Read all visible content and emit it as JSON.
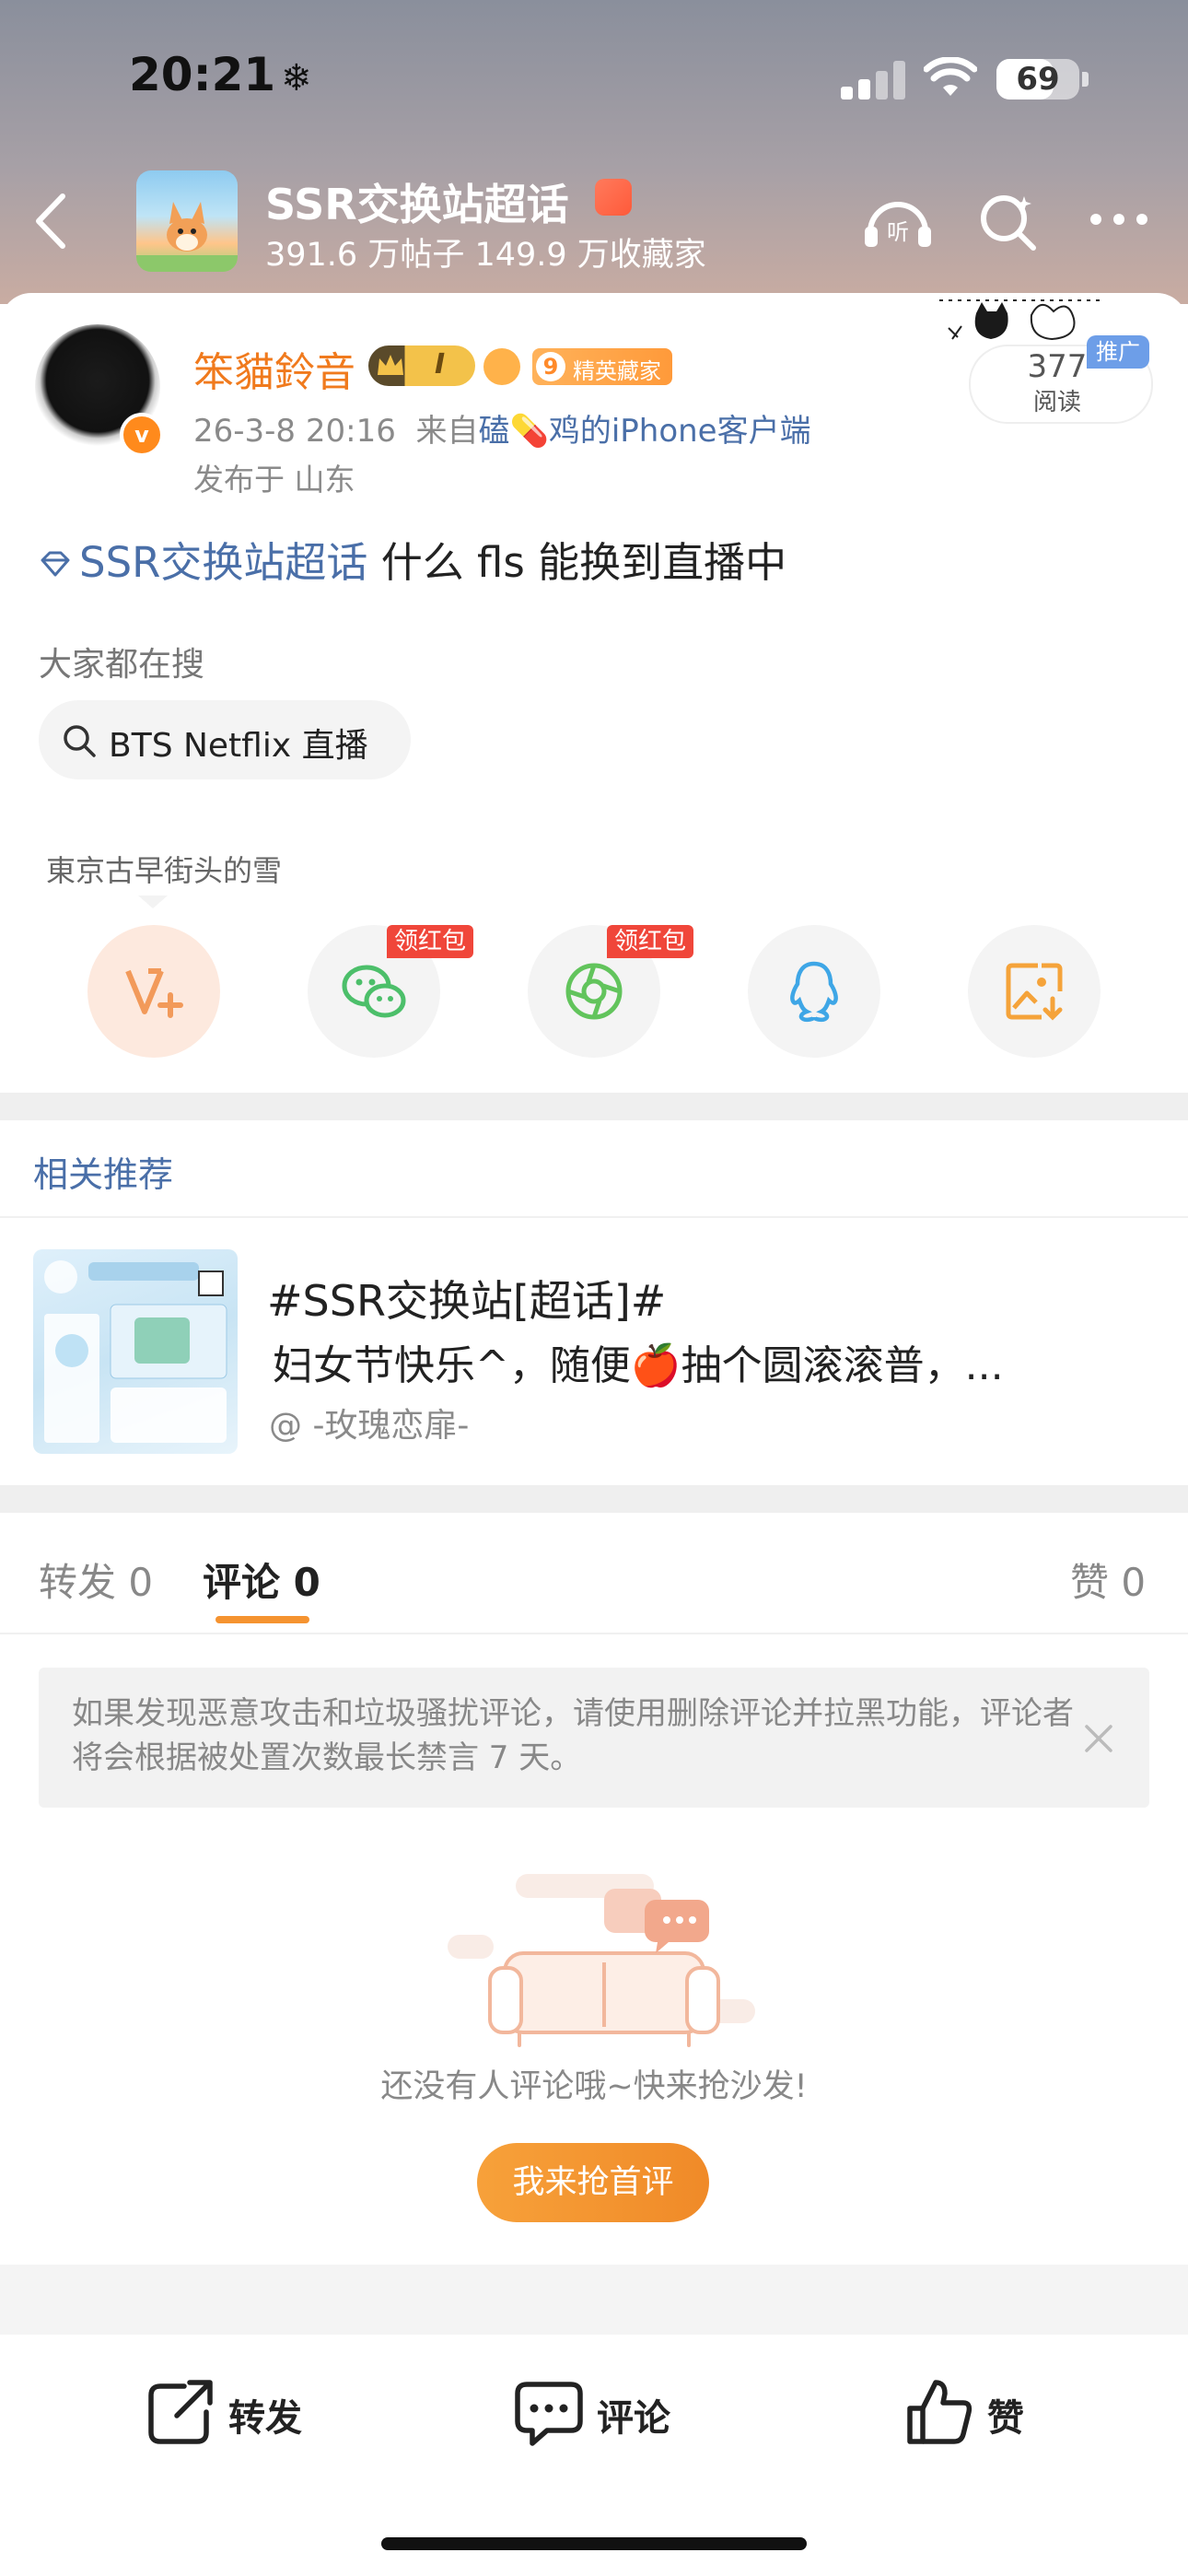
{
  "status_bar": {
    "time": "20:21",
    "time_suffix_icon": "snowflake-icon",
    "battery": "69",
    "battery_level": 0.69
  },
  "nav": {
    "topic_title": "SSR交换站超话",
    "topic_stats": "391.6 万帖子 149.9 万收藏家"
  },
  "post": {
    "author_name": "笨貓鈴音",
    "crown_level": "I",
    "vip_level": "9",
    "vip_label": "精英藏家",
    "date": "26-3-8 20:16",
    "source_prefix": "来自",
    "source": "磕💊鸡的iPhone客户端",
    "location": "发布于 山东",
    "read_count": "377",
    "read_label": "阅读",
    "promo_tag": "推广",
    "topic_link": "SSR交换站超话",
    "text": " 什么 fls 能换到直播中"
  },
  "search_suggest": {
    "heading": "大家都在搜",
    "chip": "BTS Netflix 直播"
  },
  "share": {
    "tooltip": "東京古早街头的雪",
    "redpack_label": "领红包",
    "buttons": [
      "v-plus-icon",
      "wechat-icon",
      "moments-icon",
      "qq-icon",
      "save-image-icon"
    ]
  },
  "related": {
    "heading": "相关推荐",
    "title": "#SSR交换站[超话]#",
    "body": "妇女节快乐^，随便🍎抽个圆滚滚普，...",
    "author": "@ -玫瑰恋扉-"
  },
  "tabs": {
    "repost": "转发",
    "repost_count": "0",
    "comments": "评论",
    "comments_count": "0",
    "likes": "赞",
    "likes_count": "0"
  },
  "notice": {
    "text": "如果发现恶意攻击和垃圾骚扰评论，请使用删除评论并拉黑功能，评论者将会根据被处置次数最长禁言 7 天。"
  },
  "empty_state": {
    "text": "还没有人评论哦~快来抢沙发!",
    "button": "我来抢首评"
  },
  "bottom_bar": {
    "repost": "转发",
    "comment": "评论",
    "like": "赞"
  },
  "colors": {
    "accent_orange": "#f59330",
    "link_blue": "#4a6fa8",
    "author_orange": "#f07a1d",
    "redpack_red": "#f0463a"
  }
}
